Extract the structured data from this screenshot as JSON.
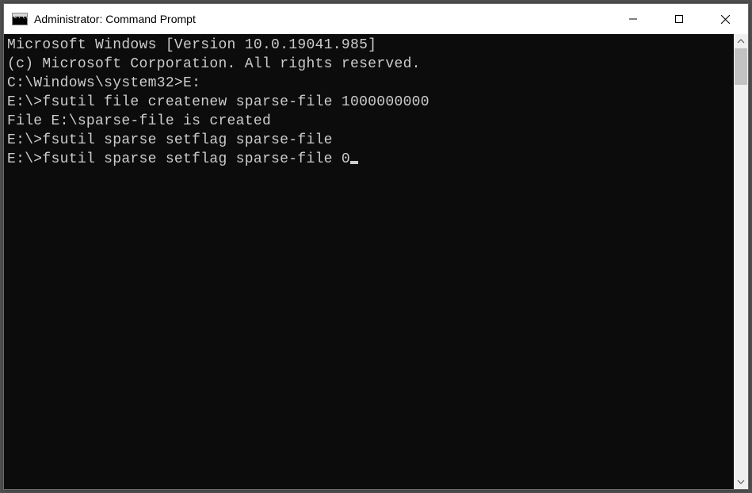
{
  "window": {
    "title": "Administrator: Command Prompt"
  },
  "cmd_icon_text": "C:\\.",
  "terminal": {
    "lines": [
      "Microsoft Windows [Version 10.0.19041.985]",
      "(c) Microsoft Corporation. All rights reserved.",
      "",
      "C:\\Windows\\system32>E:",
      "",
      "E:\\>fsutil file createnew sparse-file 1000000000",
      "File E:\\sparse-file is created",
      "",
      "E:\\>fsutil sparse setflag sparse-file",
      "",
      "E:\\>fsutil sparse setflag sparse-file 0"
    ]
  }
}
